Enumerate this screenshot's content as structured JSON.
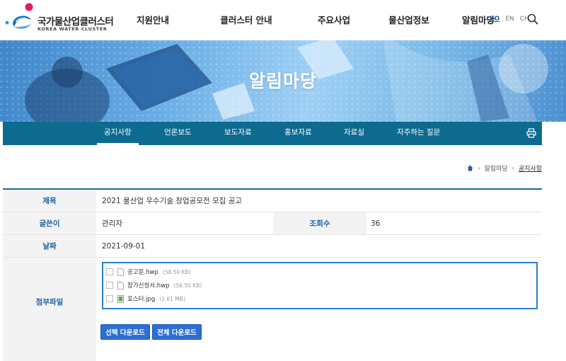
{
  "header": {
    "logo_text_ko": "국가물산업클러스터",
    "logo_text_en": "KOREA WATER CLUSTER",
    "nav": [
      "지원안내",
      "클러스터 안내",
      "주요사업",
      "물산업정보",
      "알림마당"
    ],
    "languages": [
      {
        "label": "KO",
        "active": true
      },
      {
        "label": "EN",
        "active": false
      },
      {
        "label": "CH",
        "active": false
      }
    ],
    "search_icon": "search-icon"
  },
  "banner": {
    "title": "알림마당"
  },
  "subnav": {
    "items": [
      "공지사항",
      "언론보도",
      "보도자료",
      "홍보자료",
      "자료실",
      "자주하는 질문"
    ],
    "active": "공지사항",
    "print_icon": "print-icon"
  },
  "breadcrumb": {
    "items": [
      "알림마당",
      "공지사항"
    ]
  },
  "board": {
    "title_label": "제목",
    "title_value": "2021 물산업 우수기술 창업공모전 모집 공고",
    "writer_label": "글쓴이",
    "writer_value": "관리자",
    "views_label": "조회수",
    "views_value": "36",
    "date_label": "날짜",
    "date_value": "2021-09-01",
    "attach_label": "첨부파일",
    "files": [
      {
        "name": "공고문.hwp",
        "size": "(58.50 KB)"
      },
      {
        "name": "참가신청서.hwp",
        "size": "(56.50 KB)"
      },
      {
        "name": "포스터.jpg",
        "size": "(2.61 MB)"
      }
    ],
    "buttons": {
      "download_selected": "선택 다운로드",
      "download_all": "전체 다운로드"
    }
  },
  "colors": {
    "accent": "#1b6aa5",
    "subnav_bg": "#0c6b8f",
    "button": "#2b6fd4"
  }
}
